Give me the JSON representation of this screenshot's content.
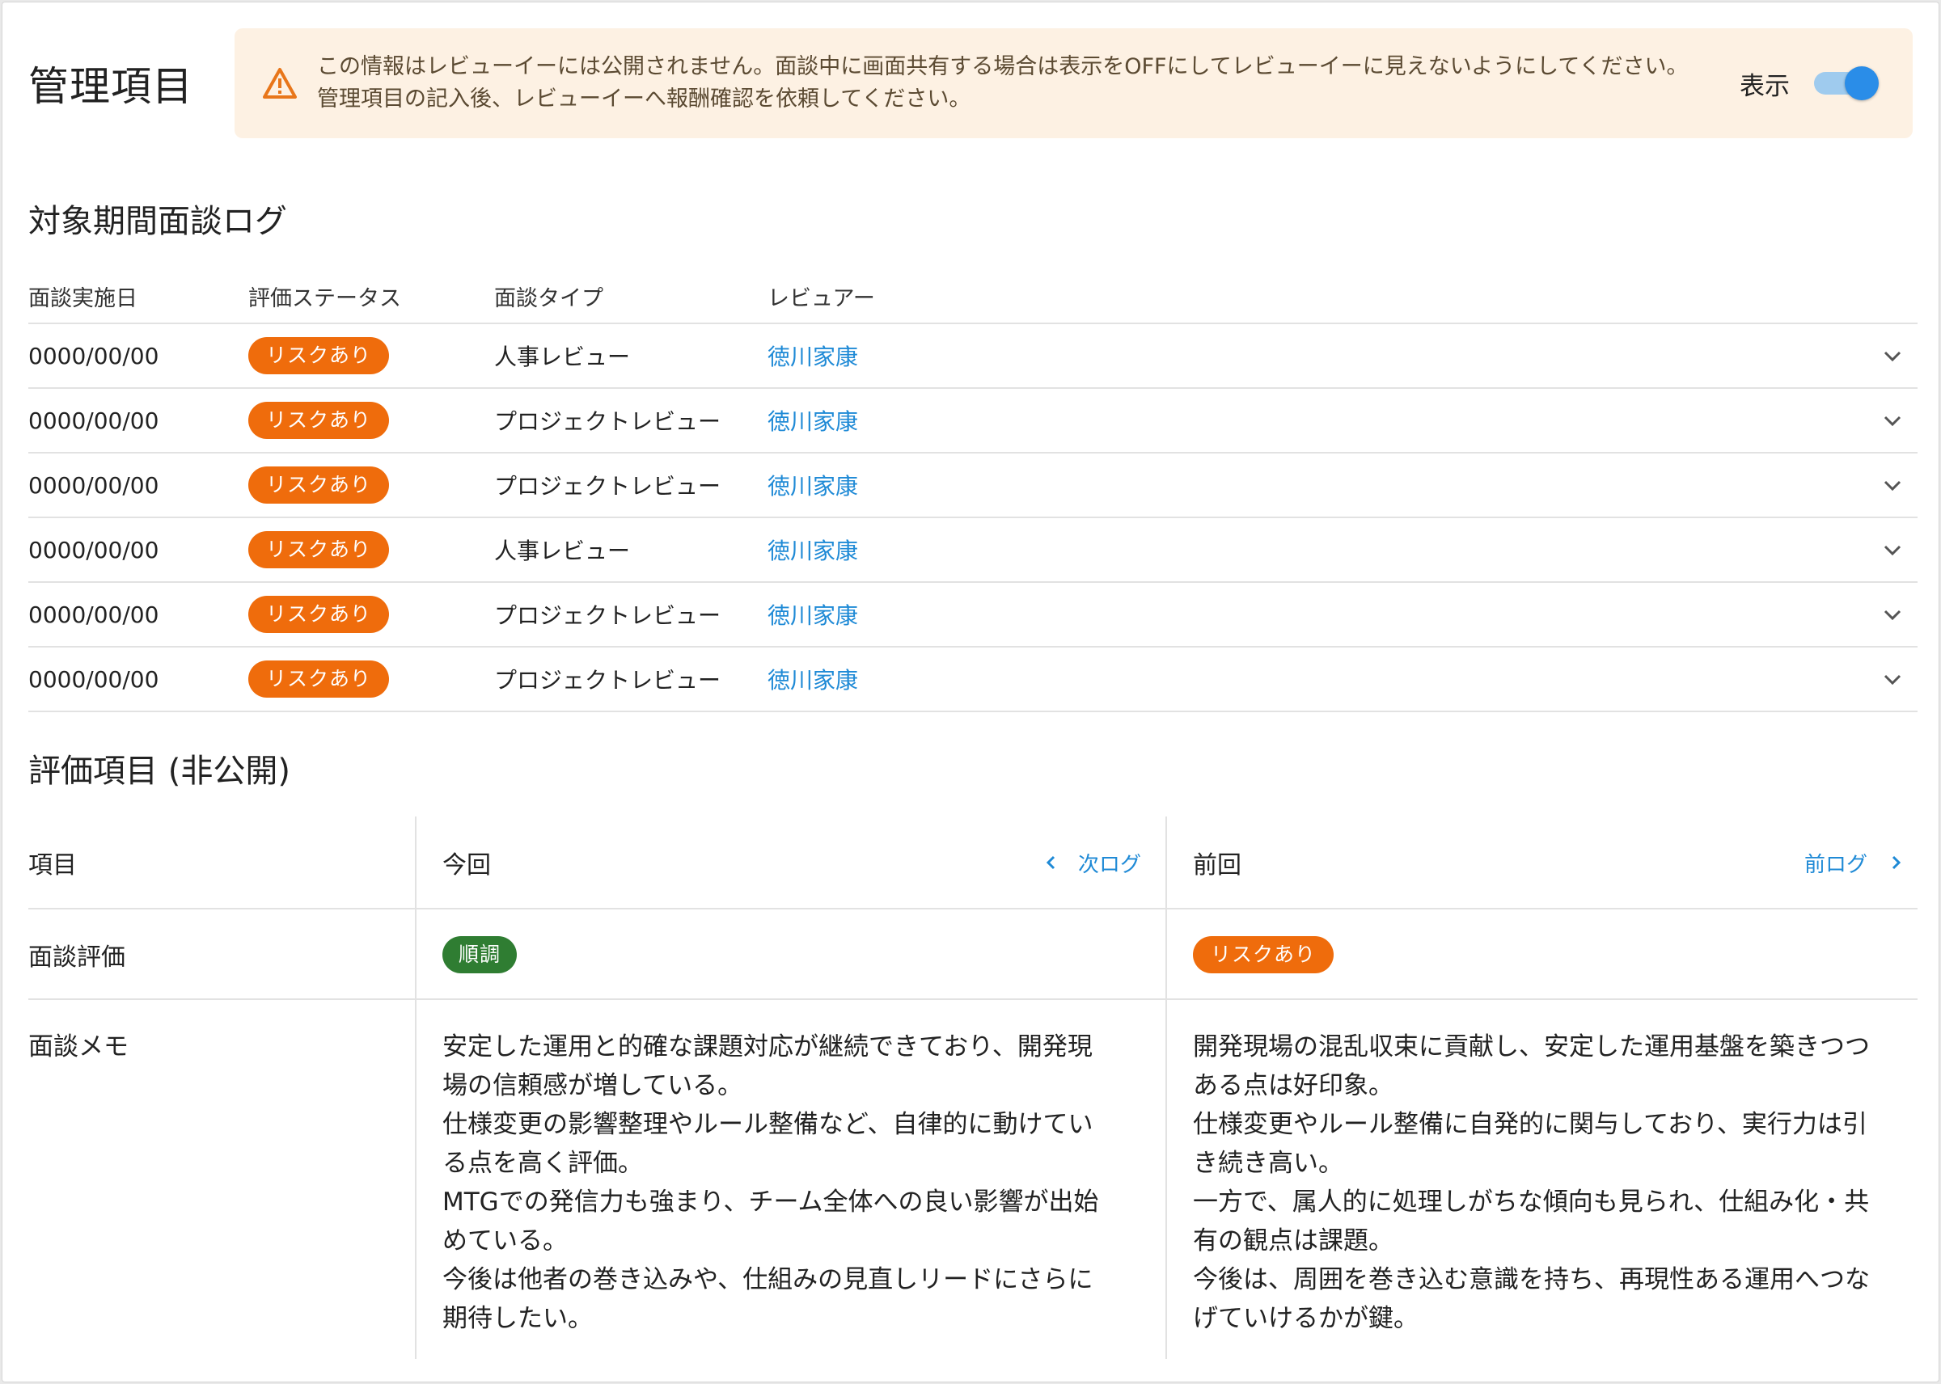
{
  "header": {
    "title": "管理項目",
    "notice": "この情報はレビューイーには公開されません。面談中に画面共有する場合は表示をOFFにしてレビューイーに見えないようにしてください。管理項目の記入後、レビューイーへ報酬確認を依頼してください。",
    "toggle_label": "表示",
    "toggle_on": true
  },
  "log_section": {
    "title": "対象期間面談ログ",
    "columns": [
      "面談実施日",
      "評価ステータス",
      "面談タイプ",
      "レビュアー"
    ],
    "rows": [
      {
        "date": "0000/00/00",
        "status": "リスクあり",
        "type": "人事レビュー",
        "reviewer": "徳川家康"
      },
      {
        "date": "0000/00/00",
        "status": "リスクあり",
        "type": "プロジェクトレビュー",
        "reviewer": "徳川家康"
      },
      {
        "date": "0000/00/00",
        "status": "リスクあり",
        "type": "プロジェクトレビュー",
        "reviewer": "徳川家康"
      },
      {
        "date": "0000/00/00",
        "status": "リスクあり",
        "type": "人事レビュー",
        "reviewer": "徳川家康"
      },
      {
        "date": "0000/00/00",
        "status": "リスクあり",
        "type": "プロジェクトレビュー",
        "reviewer": "徳川家康"
      },
      {
        "date": "0000/00/00",
        "status": "リスクあり",
        "type": "プロジェクトレビュー",
        "reviewer": "徳川家康"
      }
    ]
  },
  "eval_section": {
    "title": "評価項目 (非公開)",
    "header": {
      "item": "項目",
      "current": "今回",
      "next_log": "次ログ",
      "previous": "前回",
      "prev_log": "前ログ"
    },
    "rating_label": "面談評価",
    "current_rating": "順調",
    "previous_rating": "リスクあり",
    "memo_label": "面談メモ",
    "current_memo": [
      "安定した運用と的確な課題対応が継続できており、開発現",
      "場の信頼感が増している。",
      "仕様変更の影響整理やルール整備など、自律的に動けてい",
      "る点を高く評価。",
      "MTGでの発信力も強まり、チーム全体への良い影響が出始",
      "めている。",
      "今後は他者の巻き込みや、仕組みの見直しリードにさらに",
      "期待したい。"
    ],
    "previous_memo": [
      "開発現場の混乱収束に貢献し、安定した運用基盤を築きつつ",
      "ある点は好印象。",
      "仕様変更やルール整備に自発的に関与しており、実行力は引",
      "き続き高い。",
      "一方で、属人的に処理しがちな傾向も見られ、仕組み化・共",
      "有の観点は課題。",
      "今後は、周囲を巻き込む意識を持ち、再現性ある運用へつな",
      "げていけるかが鍵。"
    ]
  },
  "colors": {
    "risk": "#ef6c0c",
    "ok": "#2f7d32",
    "link": "#1f8ad6",
    "notice_bg": "#fdf1e3",
    "warn": "#e8761a"
  }
}
